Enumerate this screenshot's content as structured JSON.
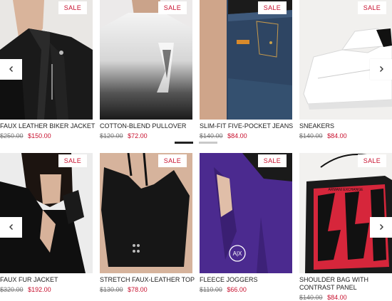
{
  "carousel_top": {
    "products": [
      {
        "name": "FAUX LEATHER BIKER JACKET",
        "old_price": "$250.00",
        "new_price": "$150.00",
        "badge": "SALE"
      },
      {
        "name": "COTTON-BLEND PULLOVER",
        "old_price": "$120.00",
        "new_price": "$72.00",
        "badge": "SALE"
      },
      {
        "name": "SLIM-FIT FIVE-POCKET JEANS",
        "old_price": "$140.00",
        "new_price": "$84.00",
        "badge": "SALE"
      },
      {
        "name": "SNEAKERS",
        "old_price": "$140.00",
        "new_price": "$84.00",
        "badge": "SALE"
      }
    ],
    "prev_icon": "chevron-left-icon",
    "next_icon": "chevron-right-icon",
    "pagination": {
      "pages": 2,
      "active": 1
    }
  },
  "carousel_bottom": {
    "products": [
      {
        "name": "FAUX FUR JACKET",
        "old_price": "$320.00",
        "new_price": "$192.00",
        "badge": "SALE"
      },
      {
        "name": "STRETCH FAUX-LEATHER TOP",
        "old_price": "$130.00",
        "new_price": "$78.00",
        "badge": "SALE"
      },
      {
        "name": "FLEECE JOGGERS",
        "old_price": "$110.00",
        "new_price": "$66.00",
        "badge": "SALE"
      },
      {
        "name": "SHOULDER BAG WITH CONTRAST PANEL",
        "old_price": "$140.00",
        "new_price": "$84.00",
        "badge": "SALE"
      }
    ],
    "prev_icon": "chevron-left-icon",
    "next_icon": "chevron-right-icon"
  },
  "photo_text": {
    "jogger_logo": "A|X",
    "bag_brand": "ARMANI EXCHANGE"
  },
  "colors": {
    "sale": "#c8102e",
    "active_dot": "#222222",
    "inactive_dot": "#c9c9c9"
  }
}
